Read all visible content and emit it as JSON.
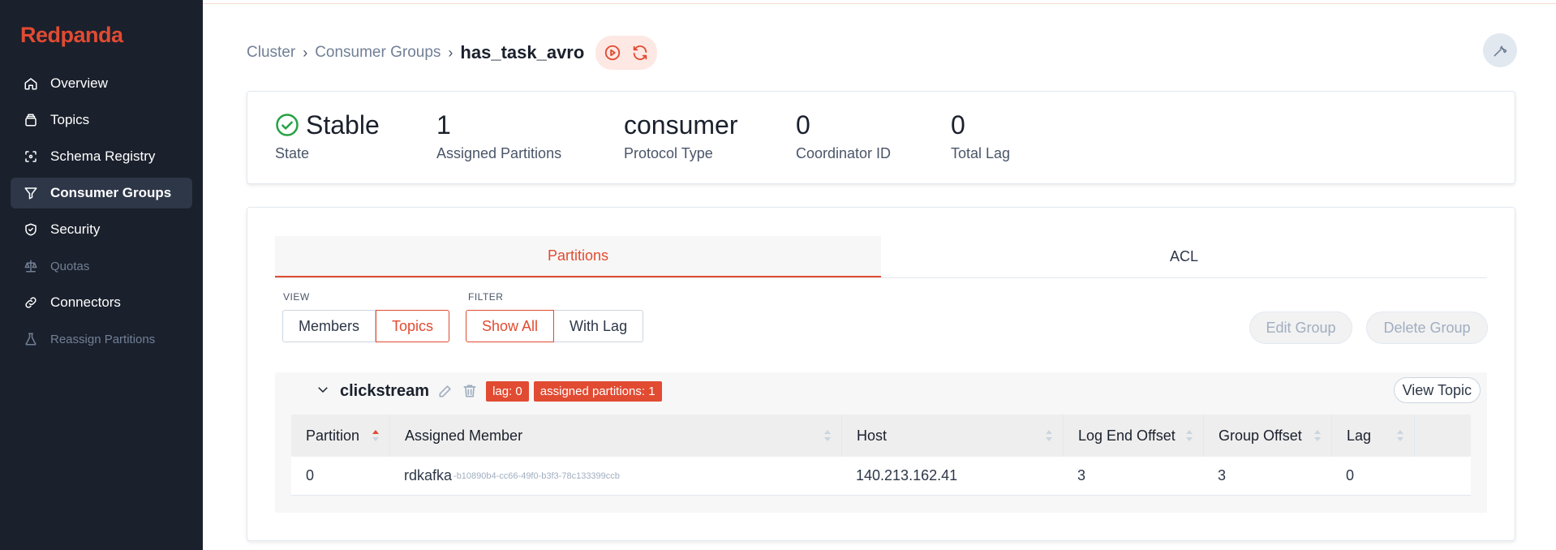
{
  "app": {
    "brand": "Redpanda"
  },
  "sidebar": {
    "items": [
      {
        "label": "Overview",
        "icon": "home-icon"
      },
      {
        "label": "Topics",
        "icon": "collection-icon"
      },
      {
        "label": "Schema Registry",
        "icon": "schema-icon"
      },
      {
        "label": "Consumer Groups",
        "icon": "funnel-icon",
        "active": true
      },
      {
        "label": "Security",
        "icon": "shield-icon"
      },
      {
        "label": "Quotas",
        "icon": "scale-icon",
        "disabled": true
      },
      {
        "label": "Connectors",
        "icon": "link-icon"
      },
      {
        "label": "Reassign Partitions",
        "icon": "beaker-icon",
        "disabled": true
      }
    ]
  },
  "header": {
    "breadcrumb": [
      "Cluster",
      "Consumer Groups"
    ],
    "current": "has_task_avro"
  },
  "stats": {
    "state_value": "Stable",
    "state_label": "State",
    "partitions_value": "1",
    "partitions_label": "Assigned Partitions",
    "protocol_value": "consumer",
    "protocol_label": "Protocol Type",
    "coordinator_value": "0",
    "coordinator_label": "Coordinator ID",
    "lag_value": "0",
    "lag_label": "Total Lag"
  },
  "tabs": {
    "partitions": "Partitions",
    "acl": "ACL"
  },
  "controls": {
    "view_label": "VIEW",
    "view_members": "Members",
    "view_topics": "Topics",
    "filter_label": "FILTER",
    "filter_all": "Show All",
    "filter_lag": "With Lag",
    "edit_group": "Edit Group",
    "delete_group": "Delete Group"
  },
  "topic": {
    "name": "clickstream",
    "lag_badge": "lag: 0",
    "partitions_badge": "assigned partitions: 1",
    "view_topic": "View Topic",
    "columns": [
      "Partition",
      "Assigned Member",
      "Host",
      "Log End Offset",
      "Group Offset",
      "Lag"
    ],
    "rows": [
      {
        "partition": "0",
        "member": "rdkafka",
        "member_id": "-b10890b4-cc66-49f0-b3f3-78c133399ccb",
        "host": "140.213.162.41",
        "log_end_offset": "3",
        "group_offset": "3",
        "lag": "0"
      }
    ]
  },
  "colors": {
    "accent": "#e14b32",
    "sidebar_bg": "#1a202c",
    "success": "#25a244"
  }
}
